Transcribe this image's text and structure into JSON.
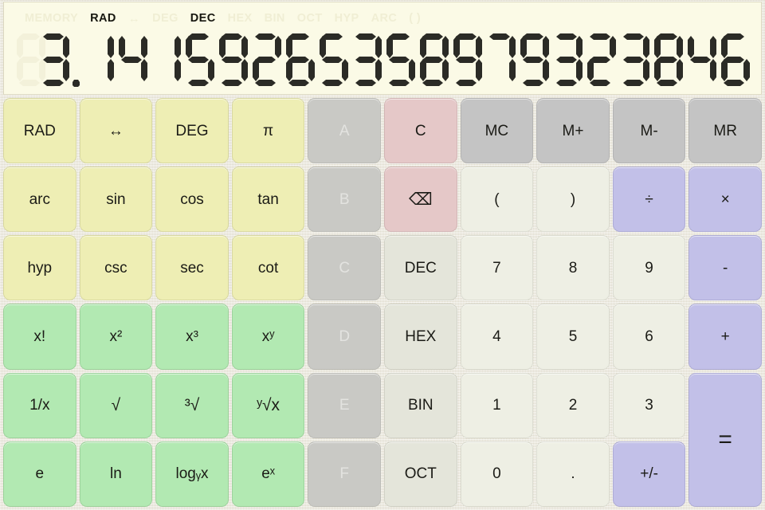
{
  "app": {
    "title": "Scientific Calculator"
  },
  "display": {
    "value": "3.14159265358979323846",
    "ghost_digits": 1,
    "indicators": [
      {
        "label": "MEMORY",
        "active": false
      },
      {
        "label": "RAD",
        "active": true
      },
      {
        "label": "↔",
        "active": false,
        "arrow": true
      },
      {
        "label": "DEG",
        "active": false
      },
      {
        "label": "DEC",
        "active": true
      },
      {
        "label": "HEX",
        "active": false
      },
      {
        "label": "BIN",
        "active": false
      },
      {
        "label": "OCT",
        "active": false
      },
      {
        "label": "HYP",
        "active": false
      },
      {
        "label": "ARC",
        "active": false
      },
      {
        "label": "( )",
        "active": false
      }
    ]
  },
  "colors": {
    "chassis": "#edeade",
    "lcd_background": "#fbfae6",
    "lcd_digit": "#2b2b26",
    "lcd_ghost": "#f3f1da",
    "function_key": "#eeeeb4",
    "power_key": "#b2e9b2",
    "hex_disabled_key": "#c9c9c5",
    "base_key": "#e4e5da",
    "clear_key": "#e5c8c8",
    "memory_key": "#c4c4c4",
    "number_key": "#eeefe4",
    "operator_key": "#c2c0e8"
  },
  "keypad": {
    "rows": [
      [
        {
          "name": "rad",
          "label": "RAD",
          "style": "k-fn",
          "disabled": false
        },
        {
          "name": "swap-angle",
          "label": "↔",
          "style": "k-fn",
          "disabled": false
        },
        {
          "name": "deg",
          "label": "DEG",
          "style": "k-fn",
          "disabled": false
        },
        {
          "name": "pi",
          "label": "π",
          "style": "k-fn",
          "disabled": false
        },
        {
          "name": "hex-a",
          "label": "A",
          "style": "k-hexdis",
          "disabled": true
        },
        {
          "name": "clear",
          "label": "C",
          "style": "k-clear",
          "disabled": false
        },
        {
          "name": "memory-clear",
          "label": "MC",
          "style": "k-mem",
          "disabled": false
        },
        {
          "name": "memory-add",
          "label": "M+",
          "style": "k-mem",
          "disabled": false
        },
        {
          "name": "memory-subtract",
          "label": "M-",
          "style": "k-mem",
          "disabled": false
        },
        {
          "name": "memory-recall",
          "label": "MR",
          "style": "k-mem",
          "disabled": false
        }
      ],
      [
        {
          "name": "arc",
          "label": "arc",
          "style": "k-fn",
          "disabled": false
        },
        {
          "name": "sin",
          "label": "sin",
          "style": "k-fn",
          "disabled": false
        },
        {
          "name": "cos",
          "label": "cos",
          "style": "k-fn",
          "disabled": false
        },
        {
          "name": "tan",
          "label": "tan",
          "style": "k-fn",
          "disabled": false
        },
        {
          "name": "hex-b",
          "label": "B",
          "style": "k-hexdis",
          "disabled": true
        },
        {
          "name": "backspace",
          "label": "⌫",
          "style": "k-clear",
          "disabled": false
        },
        {
          "name": "paren-open",
          "label": "(",
          "style": "k-paren",
          "disabled": false
        },
        {
          "name": "paren-close",
          "label": ")",
          "style": "k-paren",
          "disabled": false
        },
        {
          "name": "divide",
          "label": "÷",
          "style": "k-op",
          "disabled": false
        },
        {
          "name": "multiply",
          "label": "×",
          "style": "k-op",
          "disabled": false
        }
      ],
      [
        {
          "name": "hyp",
          "label": "hyp",
          "style": "k-fn",
          "disabled": false
        },
        {
          "name": "csc",
          "label": "csc",
          "style": "k-fn",
          "disabled": false
        },
        {
          "name": "sec",
          "label": "sec",
          "style": "k-fn",
          "disabled": false
        },
        {
          "name": "cot",
          "label": "cot",
          "style": "k-fn",
          "disabled": false
        },
        {
          "name": "hex-c",
          "label": "C",
          "style": "k-hexdis",
          "disabled": true
        },
        {
          "name": "base-dec",
          "label": "DEC",
          "style": "k-base",
          "disabled": false
        },
        {
          "name": "digit-7",
          "label": "7",
          "style": "k-num",
          "disabled": false
        },
        {
          "name": "digit-8",
          "label": "8",
          "style": "k-num",
          "disabled": false
        },
        {
          "name": "digit-9",
          "label": "9",
          "style": "k-num",
          "disabled": false
        },
        {
          "name": "subtract",
          "label": "-",
          "style": "k-op",
          "disabled": false
        }
      ],
      [
        {
          "name": "factorial",
          "label": "x!",
          "style": "k-green",
          "disabled": false
        },
        {
          "name": "square",
          "label": "x²",
          "style": "k-green",
          "disabled": false
        },
        {
          "name": "cube",
          "label": "x³",
          "style": "k-green",
          "disabled": false
        },
        {
          "name": "power-y",
          "label": "xʸ",
          "style": "k-green",
          "disabled": false
        },
        {
          "name": "hex-d",
          "label": "D",
          "style": "k-hexdis",
          "disabled": true
        },
        {
          "name": "base-hex",
          "label": "HEX",
          "style": "k-base",
          "disabled": false
        },
        {
          "name": "digit-4",
          "label": "4",
          "style": "k-num",
          "disabled": false
        },
        {
          "name": "digit-5",
          "label": "5",
          "style": "k-num",
          "disabled": false
        },
        {
          "name": "digit-6",
          "label": "6",
          "style": "k-num",
          "disabled": false
        },
        {
          "name": "add",
          "label": "+",
          "style": "k-op",
          "disabled": false
        }
      ],
      [
        {
          "name": "reciprocal",
          "label": "1/x",
          "style": "k-green",
          "disabled": false
        },
        {
          "name": "square-root",
          "label": "√",
          "style": "k-green",
          "disabled": false
        },
        {
          "name": "cube-root",
          "label": "³√",
          "style": "k-green",
          "disabled": false
        },
        {
          "name": "nth-root",
          "label": "ʸ√x",
          "style": "k-green",
          "disabled": false
        },
        {
          "name": "hex-e",
          "label": "E",
          "style": "k-hexdis",
          "disabled": true
        },
        {
          "name": "base-bin",
          "label": "BIN",
          "style": "k-base",
          "disabled": false
        },
        {
          "name": "digit-1",
          "label": "1",
          "style": "k-num",
          "disabled": false
        },
        {
          "name": "digit-2",
          "label": "2",
          "style": "k-num",
          "disabled": false
        },
        {
          "name": "digit-3",
          "label": "3",
          "style": "k-num",
          "disabled": false
        },
        {
          "name": "equals",
          "label": "=",
          "style": "k-op",
          "disabled": false
        }
      ],
      [
        {
          "name": "euler-e",
          "label": "e",
          "style": "k-green",
          "disabled": false
        },
        {
          "name": "natural-log",
          "label": "ln",
          "style": "k-green",
          "disabled": false
        },
        {
          "name": "log-base-y",
          "label": "logᵧx",
          "style": "k-green",
          "disabled": false
        },
        {
          "name": "exp",
          "label": "eˣ",
          "style": "k-green",
          "disabled": false
        },
        {
          "name": "hex-f",
          "label": "F",
          "style": "k-hexdis",
          "disabled": true
        },
        {
          "name": "base-oct",
          "label": "OCT",
          "style": "k-base",
          "disabled": false
        },
        {
          "name": "digit-0",
          "label": "0",
          "style": "k-num",
          "disabled": false
        },
        {
          "name": "decimal-point",
          "label": ".",
          "style": "k-num",
          "disabled": false
        },
        {
          "name": "sign-toggle",
          "label": "+/-",
          "style": "k-op",
          "disabled": false
        }
      ]
    ]
  }
}
